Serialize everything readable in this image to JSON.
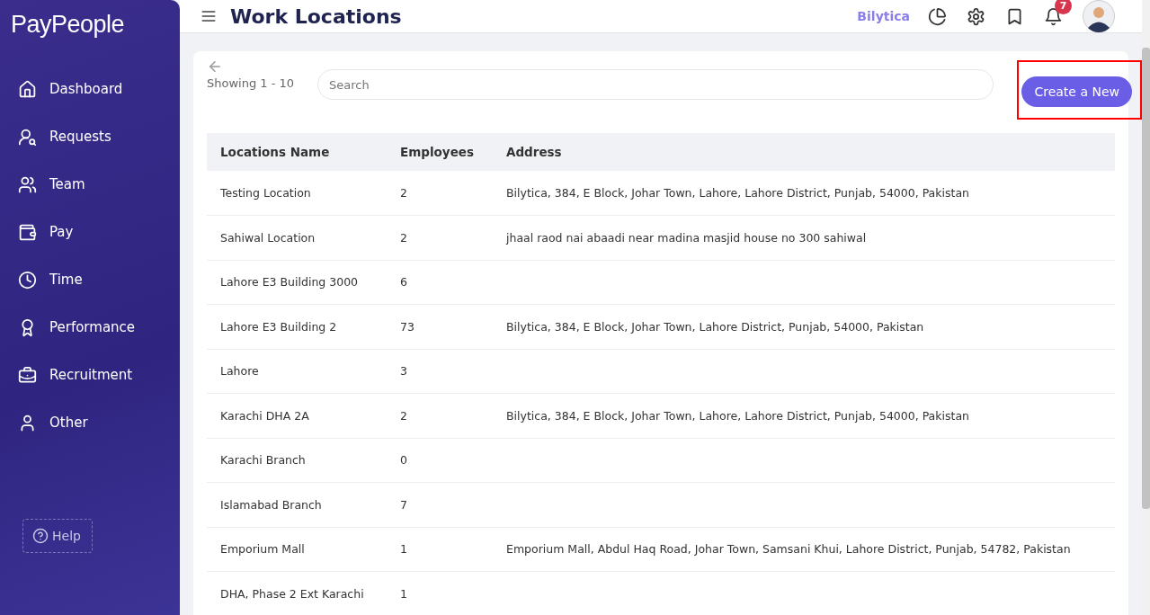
{
  "brand": {
    "logo": "PayPeople"
  },
  "sidebar": {
    "items": [
      {
        "label": "Dashboard",
        "selected": false
      },
      {
        "label": "Requests",
        "selected": false
      },
      {
        "label": "Team",
        "selected": false
      },
      {
        "label": "Pay",
        "selected": false
      },
      {
        "label": "Time",
        "selected": false
      },
      {
        "label": "Performance",
        "selected": false
      },
      {
        "label": "Recruitment",
        "selected": false
      },
      {
        "label": "Other",
        "selected": false
      }
    ],
    "help": "Help"
  },
  "header": {
    "title": "Work Locations",
    "company": "Bilytica",
    "notifications": "7"
  },
  "toolbar": {
    "showing": "Showing 1 - 10",
    "search_placeholder": "Search",
    "create_button": "Create a New",
    "create_highlighted": true
  },
  "table": {
    "columns": [
      "Locations Name",
      "Employees",
      "Address"
    ],
    "rows": [
      [
        "Testing Location",
        "2",
        "Bilytica, 384, E Block, Johar Town, Lahore, Lahore District, Punjab, 54000, Pakistan"
      ],
      [
        "Sahiwal Location",
        "2",
        "jhaal raod nai abaadi near madina masjid house no 300 sahiwal"
      ],
      [
        "Lahore E3 Building 3000",
        "6",
        ""
      ],
      [
        "Lahore E3 Building 2",
        "73",
        "Bilytica, 384, E Block, Johar Town, Lahore District, Punjab, 54000, Pakistan"
      ],
      [
        "Lahore",
        "3",
        ""
      ],
      [
        "Karachi DHA 2A",
        "2",
        "Bilytica, 384, E Block, Johar Town, Lahore, Lahore District, Punjab, 54000, Pakistan"
      ],
      [
        "Karachi Branch",
        "0",
        ""
      ],
      [
        "Islamabad Branch",
        "7",
        ""
      ],
      [
        "Emporium Mall",
        "1",
        "Emporium Mall, Abdul Haq Road, Johar Town, Samsani Khui, Lahore District, Punjab, 54782, Pakistan"
      ],
      [
        "DHA, Phase 2 Ext Karachi",
        "1",
        ""
      ]
    ]
  }
}
